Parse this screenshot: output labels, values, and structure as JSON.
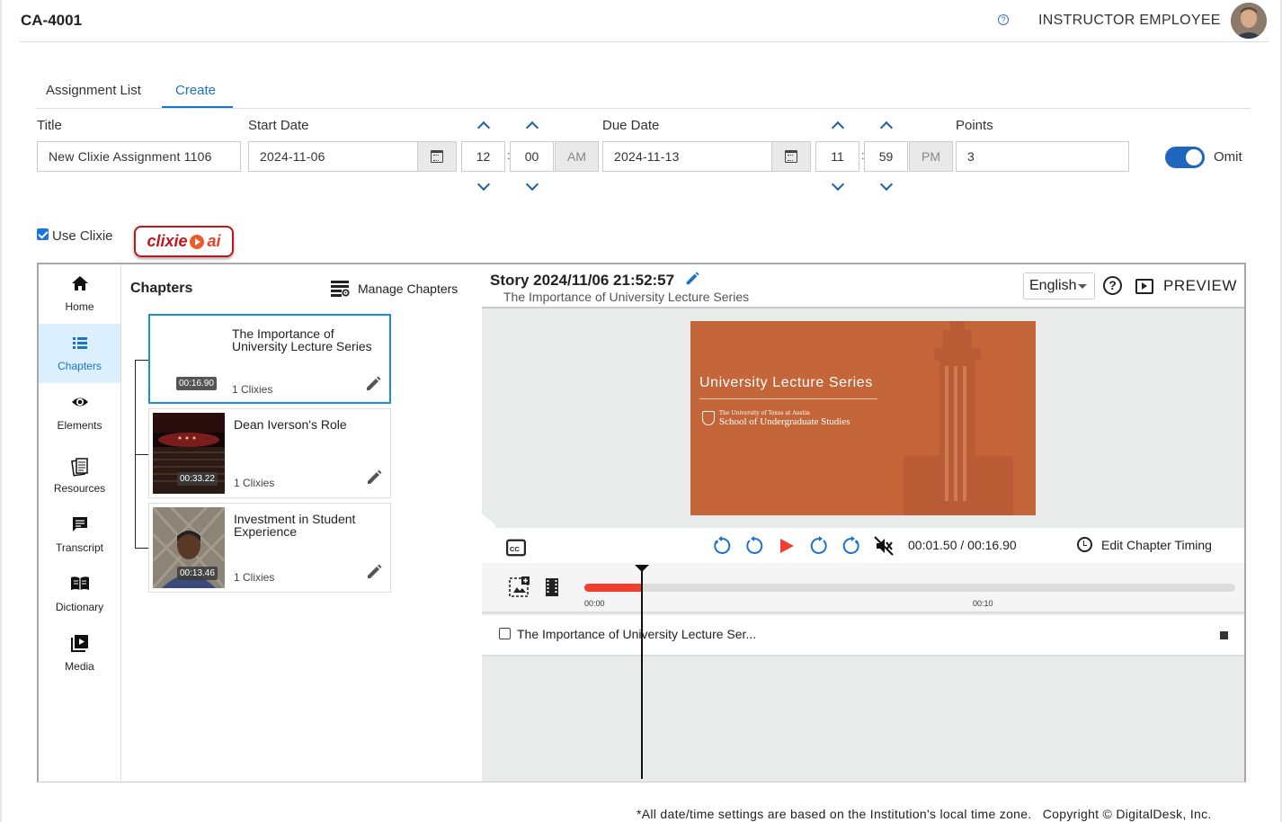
{
  "header": {
    "course_code": "CA-4001",
    "help_glyph": "?",
    "user_name": "INSTRUCTOR EMPLOYEE"
  },
  "tabs": [
    {
      "label": "Assignment List",
      "active": false
    },
    {
      "label": "Create",
      "active": true
    }
  ],
  "form": {
    "title_label": "Title",
    "title_value": "New Clixie Assignment 1106",
    "start_label": "Start Date",
    "start_date": "2024-11-06",
    "start_hour": "12",
    "start_minute": "00",
    "start_ampm": "AM",
    "due_label": "Due Date",
    "due_date": "2024-11-13",
    "due_hour": "11",
    "due_minute": "59",
    "due_ampm": "PM",
    "points_label": "Points",
    "points_value": "3",
    "omit_label": "Omit",
    "omit_enabled": true,
    "time_separator": ":"
  },
  "clixie": {
    "use_label": "Use Clixie",
    "use_checked": true,
    "logo_word": "clixie",
    "logo_ai": "ai"
  },
  "sidenav": [
    {
      "label": "Home",
      "icon": "home-icon"
    },
    {
      "label": "Chapters",
      "icon": "list-icon",
      "active": true
    },
    {
      "label": "Elements",
      "icon": "eye-icon"
    },
    {
      "label": "Resources",
      "icon": "documents-icon"
    },
    {
      "label": "Transcript",
      "icon": "chat-icon"
    },
    {
      "label": "Dictionary",
      "icon": "book-icon"
    },
    {
      "label": "Media",
      "icon": "media-icon"
    }
  ],
  "chapters": {
    "title": "Chapters",
    "manage_label": "Manage Chapters",
    "items": [
      {
        "title": "The Importance of University Lecture Series",
        "duration": "00:16.90",
        "count": "1 Clixies",
        "active": true
      },
      {
        "title": "Dean Iverson's Role",
        "duration": "00:33.22",
        "count": "1 Clixies",
        "active": false
      },
      {
        "title": "Investment in Student Experience",
        "duration": "00:13.46",
        "count": "1 Clixies",
        "active": false
      }
    ]
  },
  "story": {
    "title": "Story 2024/11/06 21:52:57",
    "subtitle": "The Importance of University Lecture Series",
    "language": "English",
    "preview_label": "PREVIEW",
    "help_glyph": "?"
  },
  "slide": {
    "title": "University Lecture Series",
    "institution_small": "The University of Texas at Austin",
    "institution": "School of Undergraduate Studies",
    "bg_color": "#c4663a"
  },
  "player": {
    "time": "00:01.50 / 00:16.90",
    "edit_timing_label": "Edit Chapter Timing",
    "progress": 0.0888,
    "tick_start": "00:00",
    "tick_mid": "00:10"
  },
  "element_row": {
    "label": "The Importance of University Lecture Ser..."
  },
  "footer": {
    "note": "*All date/time settings are based on the Institution's local time zone.",
    "copyright": "Copyright © DigitalDesk, Inc."
  },
  "colors": {
    "accent": "#1a73c9",
    "toggle": "#1e66c0",
    "progress": "#f03e2f",
    "brand_red": "#c0171c"
  }
}
